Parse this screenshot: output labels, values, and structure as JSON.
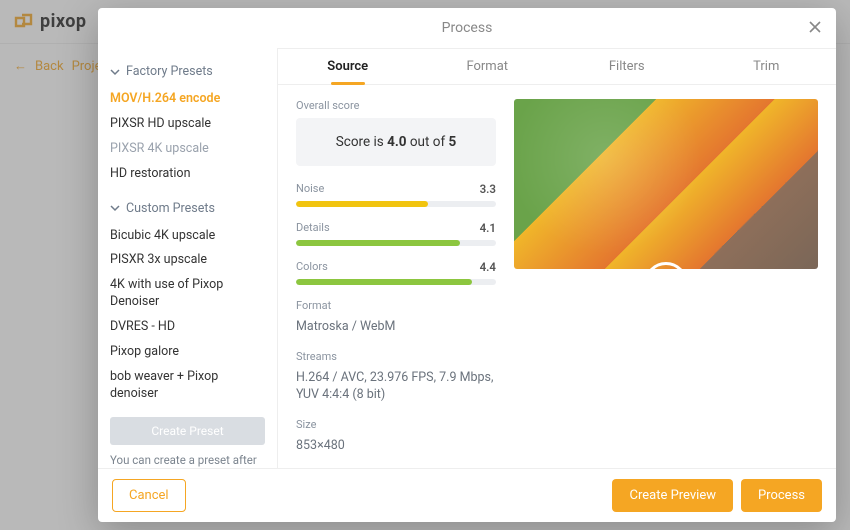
{
  "brand": {
    "name": "pixop"
  },
  "breadcrumb": {
    "back": "Back",
    "projects": "Projects",
    "sep": "/"
  },
  "modal": {
    "title": "Process",
    "tabs": [
      "Source",
      "Format",
      "Filters",
      "Trim"
    ],
    "active_tab": 0,
    "sidebar": {
      "factory_header": "Factory Presets",
      "factory": [
        {
          "label": "MOV/H.264 encode",
          "state": "sel"
        },
        {
          "label": "PIXSR HD upscale",
          "state": ""
        },
        {
          "label": "PIXSR 4K upscale",
          "state": "dim"
        },
        {
          "label": "HD restoration",
          "state": ""
        }
      ],
      "custom_header": "Custom Presets",
      "custom": [
        {
          "label": "Bicubic 4K upscale"
        },
        {
          "label": "PISXR 3x upscale"
        },
        {
          "label": "4K with use of Pixop Denoiser"
        },
        {
          "label": "DVRES - HD"
        },
        {
          "label": "Pixop galore"
        },
        {
          "label": "bob weaver + Pixop denoiser"
        }
      ],
      "create_label": "Create Preset",
      "hint": "You can create a preset after changing the processing configuration."
    },
    "source": {
      "overall_label": "Overall score",
      "score_prefix": "Score is ",
      "score_value": "4.0",
      "score_middle": " out of ",
      "score_max": "5",
      "meters": [
        {
          "label": "Noise",
          "value": "3.3",
          "pct": 66,
          "color": "#f1c40f"
        },
        {
          "label": "Details",
          "value": "4.1",
          "pct": 82,
          "color": "#8cc63f"
        },
        {
          "label": "Colors",
          "value": "4.4",
          "pct": 88,
          "color": "#8cc63f"
        }
      ],
      "format_label": "Format",
      "format_value": "Matroska / WebM",
      "streams_label": "Streams",
      "streams_value": "H.264 / AVC, 23.976 FPS, 7.9 Mbps, YUV 4:4:4 (8 bit)",
      "size_label": "Size",
      "size_value": "853×480"
    },
    "footer": {
      "cancel": "Cancel",
      "preview": "Create Preview",
      "process": "Process"
    }
  }
}
